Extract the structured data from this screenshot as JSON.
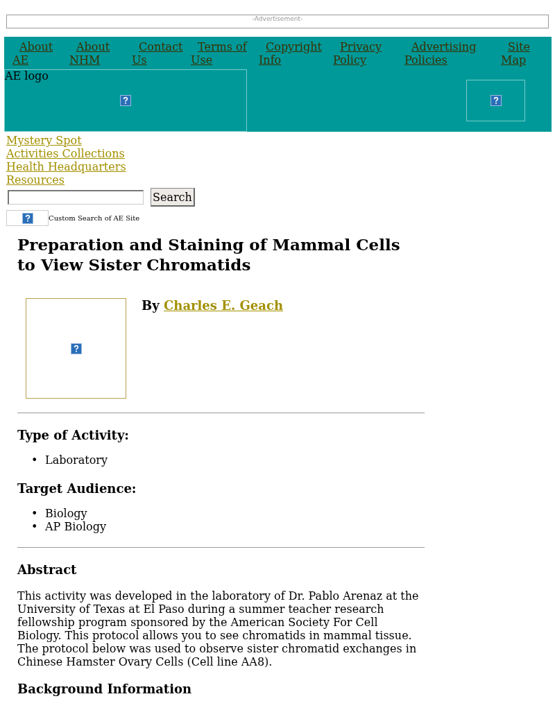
{
  "advertisement": {
    "label": "-Advertisement-"
  },
  "nav": [
    {
      "label": "About AE"
    },
    {
      "label": "About NHM"
    },
    {
      "label": "Contact Us"
    },
    {
      "label": "Terms of Use"
    },
    {
      "label": "Copyright Info"
    },
    {
      "label": "Privacy Policy"
    },
    {
      "label": "Advertising Policies"
    },
    {
      "label": "Site Map"
    }
  ],
  "logo": {
    "alt": "AE logo"
  },
  "side_links": [
    {
      "label": "Mystery Spot"
    },
    {
      "label": "Activities Collections"
    },
    {
      "label": "Health Headquarters"
    },
    {
      "label": "Resources"
    }
  ],
  "search": {
    "button": "Search",
    "caption": "Custom Search of AE Site"
  },
  "article": {
    "title": "Preparation and Staining of Mammal Cells to View Sister Chromatids",
    "by": "By",
    "author": "Charles E. Geach",
    "sections": [
      {
        "heading": "Type of Activity:",
        "marker": "•",
        "items": [
          "Laboratory"
        ]
      },
      {
        "heading": "Target Audience:",
        "marker": "•",
        "items": [
          "Biology",
          "AP Biology"
        ]
      }
    ],
    "abstract_heading": "Abstract",
    "abstract": "This activity was developed in the laboratory of Dr. Pablo Arenaz at the University of Texas at El Paso during a summer teacher research fellowship program sponsored by the American Society For Cell Biology. This protocol allows you to see chromatids in mammal tissue. The protocol below was used to observe sister chromatid exchanges in Chinese Hamster Ovary Cells (Cell line AA8).",
    "next_heading": "Background Information"
  }
}
